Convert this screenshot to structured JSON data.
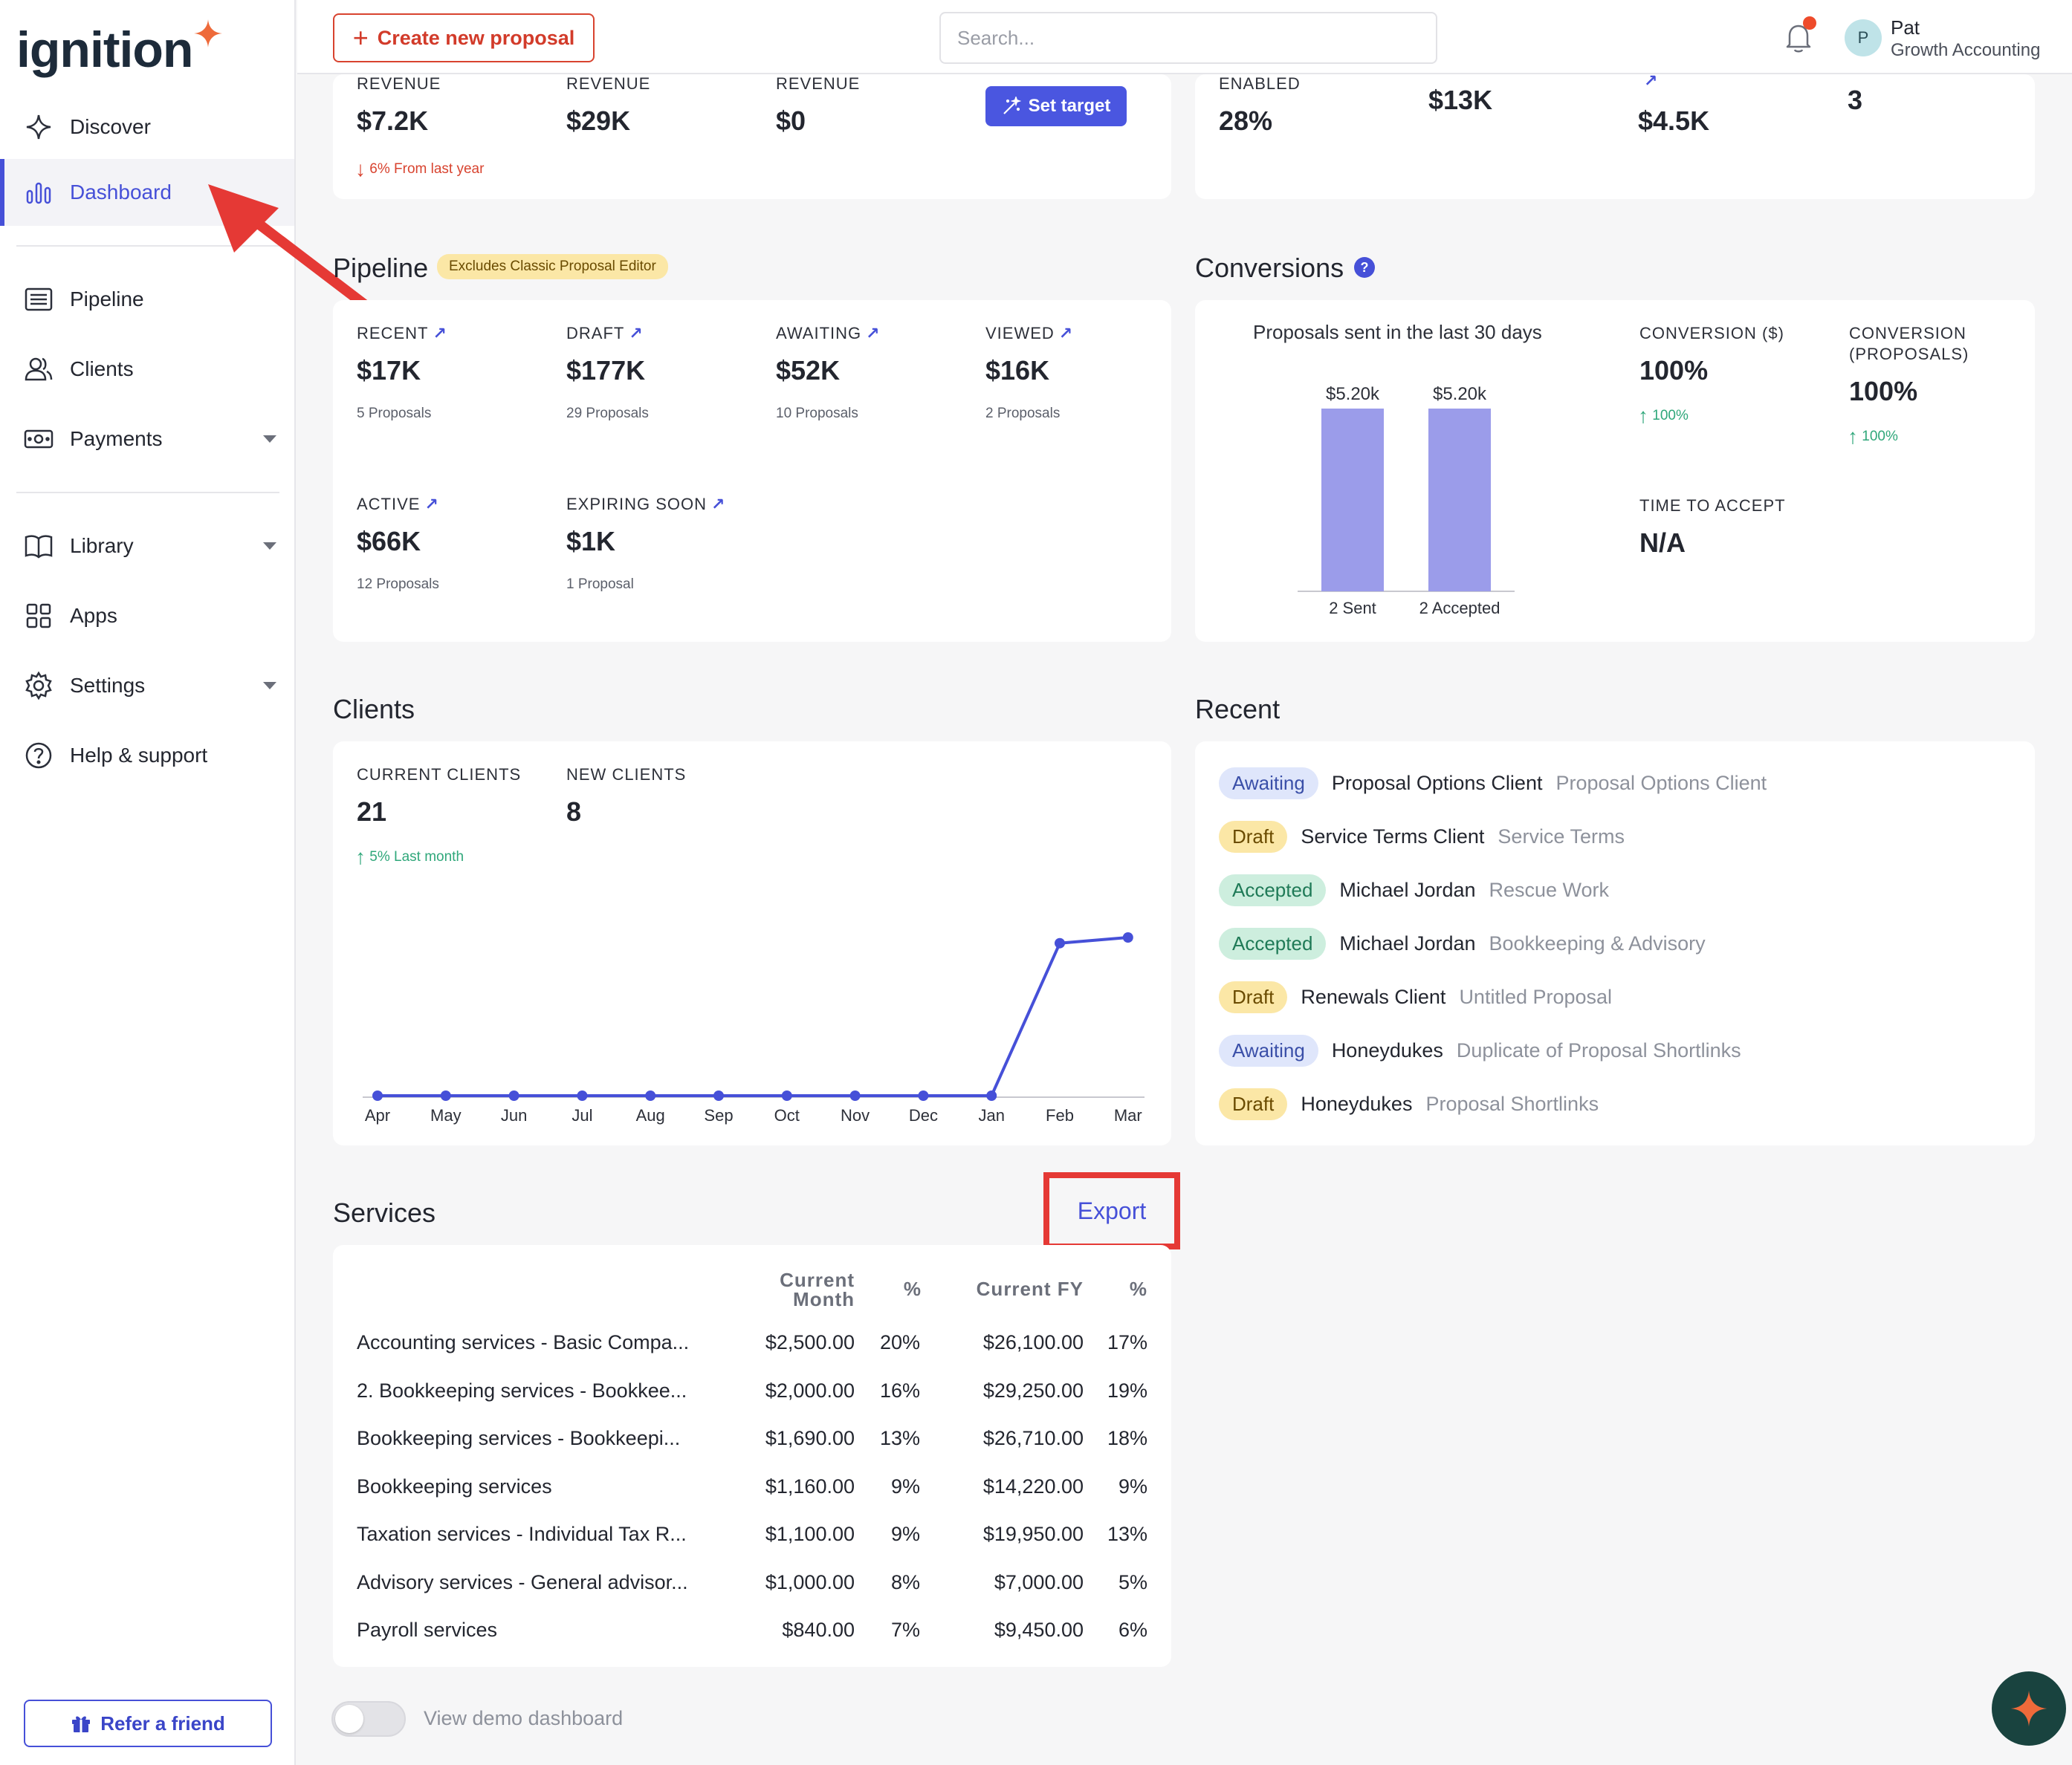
{
  "brand": {
    "name": "ignition",
    "accent": "#4650d8",
    "brand_star": "#ee6a3a"
  },
  "sidebar": {
    "items": [
      {
        "label": "Discover",
        "icon": "sparkle-icon"
      },
      {
        "label": "Dashboard",
        "icon": "bar-chart-icon",
        "active": true
      },
      {
        "label": "Pipeline",
        "icon": "list-icon"
      },
      {
        "label": "Clients",
        "icon": "users-icon"
      },
      {
        "label": "Payments",
        "icon": "banknote-icon",
        "caret": true
      },
      {
        "label": "Library",
        "icon": "book-icon",
        "caret": true
      },
      {
        "label": "Apps",
        "icon": "grid-icon"
      },
      {
        "label": "Settings",
        "icon": "gear-icon",
        "caret": true
      },
      {
        "label": "Help & support",
        "icon": "help-icon"
      }
    ],
    "refer": "Refer a friend"
  },
  "topbar": {
    "create": "Create new proposal",
    "search_placeholder": "Search...",
    "user_initial": "P",
    "user_name": "Pat",
    "user_org": "Growth Accounting"
  },
  "revenue": {
    "items": [
      {
        "label": "REVENUE",
        "value": "$7.2K"
      },
      {
        "label": "REVENUE",
        "value": "$29K"
      },
      {
        "label": "REVENUE",
        "value": "$0"
      }
    ],
    "trend": "6% From last year",
    "set_target": "Set target"
  },
  "top_right": {
    "enabled_label": "ENABLED",
    "enabled_value": "28%",
    "v2": "$13K",
    "v3": "$4.5K",
    "v4": "3"
  },
  "pipeline": {
    "title": "Pipeline",
    "badge": "Excludes Classic Proposal Editor",
    "items": [
      {
        "label": "RECENT",
        "value": "$17K",
        "sub": "5 Proposals"
      },
      {
        "label": "DRAFT",
        "value": "$177K",
        "sub": "29 Proposals"
      },
      {
        "label": "AWAITING",
        "value": "$52K",
        "sub": "10 Proposals"
      },
      {
        "label": "VIEWED",
        "value": "$16K",
        "sub": "2 Proposals"
      },
      {
        "label": "ACTIVE",
        "value": "$66K",
        "sub": "12 Proposals"
      },
      {
        "label": "EXPIRING SOON",
        "value": "$1K",
        "sub": "1 Proposal"
      }
    ]
  },
  "conversions": {
    "title": "Conversions",
    "info": "?",
    "chart_title": "Proposals sent in the last 30 days",
    "conv_dollar_label": "CONVERSION ($)",
    "conv_dollar_value": "100%",
    "conv_dollar_trend": "100%",
    "conv_prop_label_1": "CONVERSION",
    "conv_prop_label_2": "(PROPOSALS)",
    "conv_prop_value": "100%",
    "conv_prop_trend": "100%",
    "tta_label": "TIME TO ACCEPT",
    "tta_value": "N/A"
  },
  "clients": {
    "title": "Clients",
    "current_label": "CURRENT CLIENTS",
    "current_value": "21",
    "current_trend": "5% Last month",
    "new_label": "NEW CLIENTS",
    "new_value": "8"
  },
  "recent": {
    "title": "Recent",
    "rows": [
      {
        "status": "Awaiting",
        "kind": "awaiting",
        "client": "Proposal Options Client",
        "proposal": "Proposal Options Client"
      },
      {
        "status": "Draft",
        "kind": "draft",
        "client": "Service Terms Client",
        "proposal": "Service Terms"
      },
      {
        "status": "Accepted",
        "kind": "accepted",
        "client": "Michael Jordan",
        "proposal": "Rescue Work"
      },
      {
        "status": "Accepted",
        "kind": "accepted",
        "client": "Michael Jordan",
        "proposal": "Bookkeeping & Advisory"
      },
      {
        "status": "Draft",
        "kind": "draft",
        "client": "Renewals Client",
        "proposal": "Untitled Proposal"
      },
      {
        "status": "Awaiting",
        "kind": "awaiting",
        "client": "Honeydukes",
        "proposal": "Duplicate of Proposal Shortlinks"
      },
      {
        "status": "Draft",
        "kind": "draft",
        "client": "Honeydukes",
        "proposal": "Proposal Shortlinks"
      }
    ]
  },
  "services": {
    "title": "Services",
    "export": "Export",
    "headers": {
      "current_month_1": "Current",
      "current_month_2": "Month",
      "pct1": "%",
      "current_fy": "Current FY",
      "pct2": "%"
    },
    "rows": [
      {
        "name": "Accounting services - Basic Compa...",
        "month": "$2,500.00",
        "pct1": "20%",
        "fy": "$26,100.00",
        "pct2": "17%"
      },
      {
        "name": "2. Bookkeeping services - Bookkee...",
        "month": "$2,000.00",
        "pct1": "16%",
        "fy": "$29,250.00",
        "pct2": "19%"
      },
      {
        "name": "Bookkeeping services - Bookkeepi...",
        "month": "$1,690.00",
        "pct1": "13%",
        "fy": "$26,710.00",
        "pct2": "18%"
      },
      {
        "name": "Bookkeeping services",
        "month": "$1,160.00",
        "pct1": "9%",
        "fy": "$14,220.00",
        "pct2": "9%"
      },
      {
        "name": "Taxation services - Individual Tax R...",
        "month": "$1,100.00",
        "pct1": "9%",
        "fy": "$19,950.00",
        "pct2": "13%"
      },
      {
        "name": "Advisory services - General advisor...",
        "month": "$1,000.00",
        "pct1": "8%",
        "fy": "$7,000.00",
        "pct2": "5%"
      },
      {
        "name": "Payroll services",
        "month": "$840.00",
        "pct1": "7%",
        "fy": "$9,450.00",
        "pct2": "6%"
      }
    ]
  },
  "demo_toggle": {
    "label": "View demo dashboard",
    "on": false
  },
  "chart_data": [
    {
      "type": "bar",
      "title": "Proposals sent in the last 30 days",
      "categories": [
        "2 Sent",
        "2 Accepted"
      ],
      "values": [
        5200,
        5200
      ],
      "data_labels": [
        "$5.20k",
        "$5.20k"
      ],
      "color": "#9b9cea"
    },
    {
      "type": "line",
      "categories": [
        "Apr",
        "May",
        "Jun",
        "Jul",
        "Aug",
        "Sep",
        "Oct",
        "Nov",
        "Dec",
        "Jan",
        "Feb",
        "Mar"
      ],
      "values": [
        0,
        0,
        0,
        0,
        0,
        0,
        0,
        0,
        0,
        0,
        8,
        8.3
      ],
      "color": "#4650d8"
    }
  ]
}
